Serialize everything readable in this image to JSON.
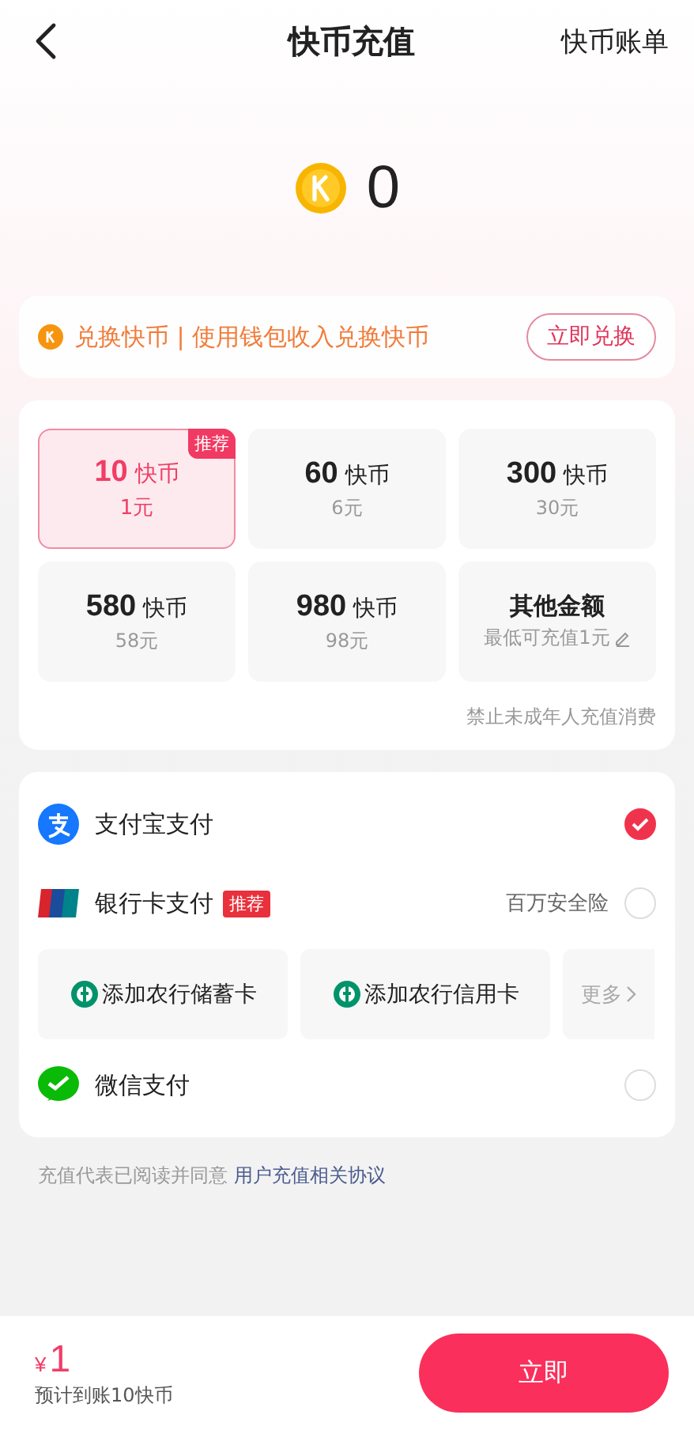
{
  "header": {
    "title": "快币充值",
    "right_link": "快币账单"
  },
  "balance": {
    "amount": "0"
  },
  "exchange": {
    "text": "兑换快币 | 使用钱包收入兑换快币",
    "button": "立即兑换"
  },
  "packages": [
    {
      "kind": "package",
      "coins": "10",
      "unit": "快币",
      "price": "1元",
      "badge": "推荐",
      "selected": true
    },
    {
      "kind": "package",
      "coins": "60",
      "unit": "快币",
      "price": "6元",
      "selected": false
    },
    {
      "kind": "package",
      "coins": "300",
      "unit": "快币",
      "price": "30元",
      "selected": false
    },
    {
      "kind": "package",
      "coins": "580",
      "unit": "快币",
      "price": "58元",
      "selected": false
    },
    {
      "kind": "package",
      "coins": "980",
      "unit": "快币",
      "price": "98元",
      "selected": false
    },
    {
      "kind": "custom",
      "title": "其他金额",
      "price": "最低可充值1元",
      "selected": false
    }
  ],
  "notice": "禁止未成年人充值消费",
  "payments": [
    {
      "kind": "alipay",
      "name": "支付宝支付",
      "selected": true
    },
    {
      "kind": "bank",
      "name": "银行卡支付",
      "badge": "推荐",
      "note": "百万安全险",
      "selected": false,
      "options": [
        "添加农行储蓄卡",
        "添加农行信用卡"
      ],
      "more": "更多"
    },
    {
      "kind": "wechat",
      "name": "微信支付",
      "selected": false
    }
  ],
  "agreement": {
    "text": "充值代表已阅读并同意",
    "link": "用户充值相关协议"
  },
  "footer": {
    "currency": "¥",
    "amount": "1",
    "note": "预计到账10快币",
    "button": "立即"
  }
}
